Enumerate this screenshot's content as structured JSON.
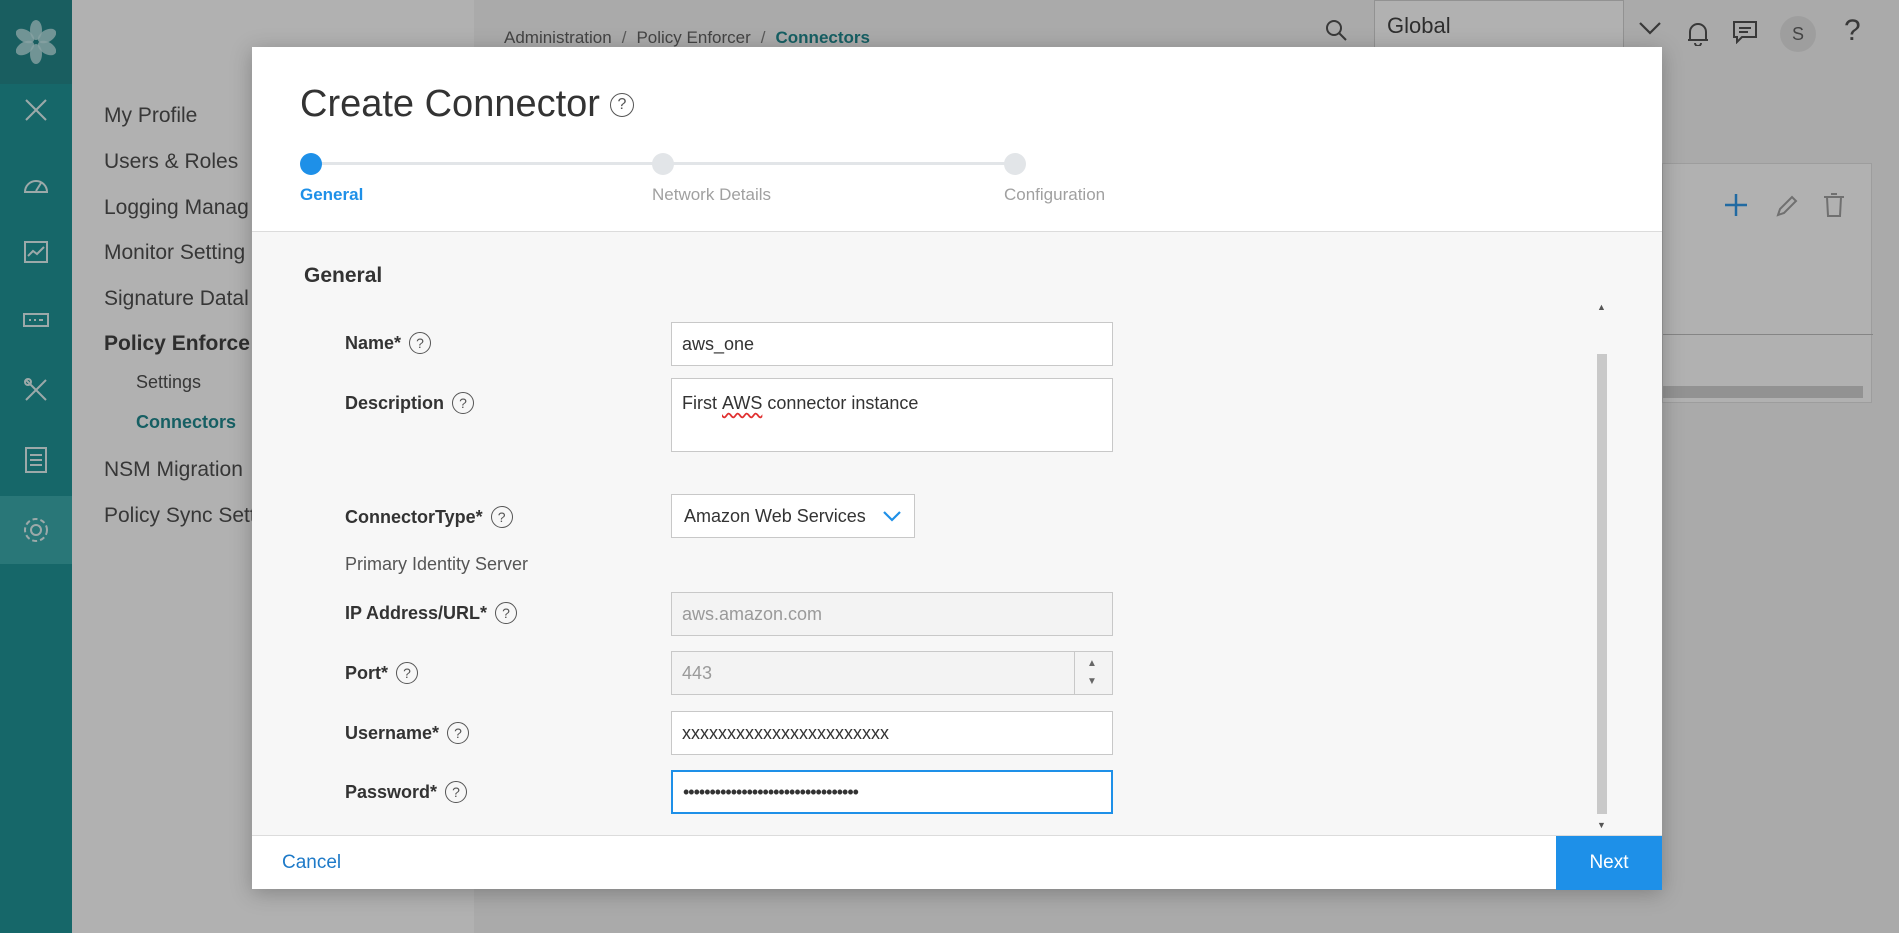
{
  "colors": {
    "rail": "#0e8c8f",
    "accent": "#1e90e8",
    "active_nav": "#0e7f85"
  },
  "rail": {
    "icons": [
      "logo-icon",
      "close-icon",
      "dashboard-icon",
      "monitor-icon",
      "devices-icon",
      "configure-icon",
      "reports-icon",
      "settings-icon"
    ]
  },
  "subnav": {
    "items": [
      "My Profile",
      "Users & Roles",
      "Logging Manag",
      "Monitor Setting",
      "Signature Datal",
      "Policy Enforce",
      "NSM Migration",
      "Policy Sync Sett"
    ],
    "subitems": [
      "Settings",
      "Connectors"
    ]
  },
  "header": {
    "breadcrumb": [
      "Administration",
      "Policy Enforcer",
      "Connectors"
    ],
    "scope": "Global",
    "avatar_initial": "S"
  },
  "modal": {
    "title": "Create Connector",
    "steps": [
      "General",
      "Network Details",
      "Configuration"
    ],
    "section_title": "General",
    "fields": {
      "name_label": "Name*",
      "name_value": "aws_one",
      "description_label": "Description",
      "description_value_prefix": "First ",
      "description_value_spell": "AWS",
      "description_value_suffix": " connector instance",
      "type_label": "ConnectorType*",
      "type_value": "Amazon Web Services",
      "primary_server_label": "Primary Identity Server",
      "ip_label": "IP Address/URL*",
      "ip_placeholder": "aws.amazon.com",
      "port_label": "Port*",
      "port_placeholder": "443",
      "username_label": "Username*",
      "username_value": "xxxxxxxxxxxxxxxxxxxxxxx",
      "password_label": "Password*",
      "password_value": "•••••••••••••••••••••••••••••••••"
    },
    "footer": {
      "cancel": "Cancel",
      "next": "Next"
    }
  }
}
